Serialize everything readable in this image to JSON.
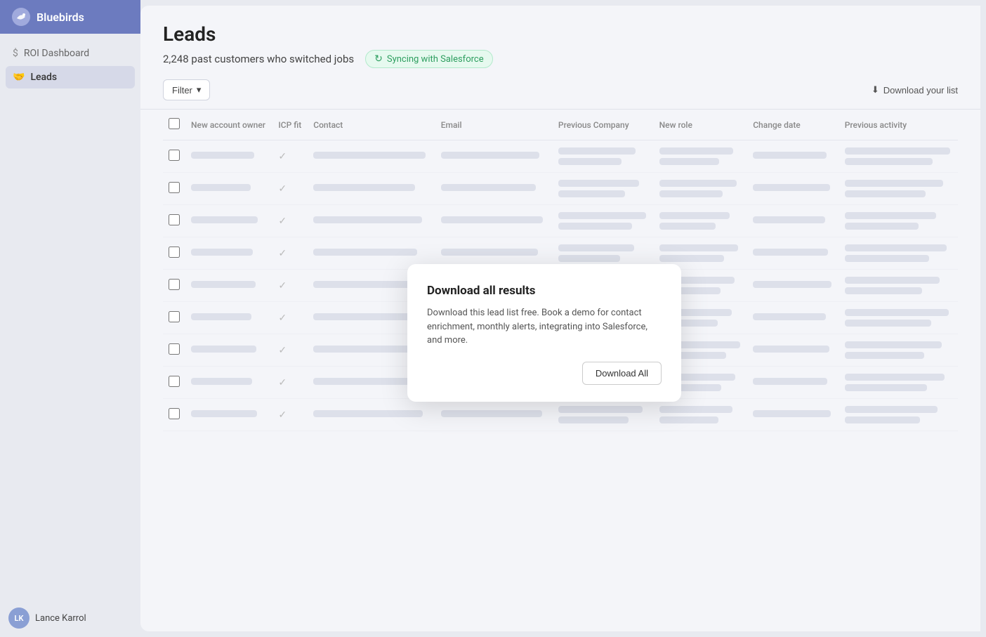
{
  "app": {
    "name": "Bluebirds",
    "logo_icon": "🐦"
  },
  "sidebar": {
    "nav_items": [
      {
        "id": "roi-dashboard",
        "label": "ROI Dashboard",
        "icon": "$",
        "active": false
      },
      {
        "id": "leads",
        "label": "Leads",
        "icon": "🤝",
        "active": true
      }
    ],
    "user": {
      "initials": "LK",
      "name": "Lance Karrol"
    }
  },
  "main": {
    "page_title": "Leads",
    "subtitle": "2,248 past customers who switched jobs",
    "sync_label": "Syncing with Salesforce",
    "filter_label": "Filter",
    "download_list_label": "Download your list",
    "table": {
      "columns": [
        "New account owner",
        "ICP fit",
        "Contact",
        "Email",
        "Previous Company",
        "New role",
        "Change date",
        "Previous activity"
      ],
      "rows": 9
    },
    "popup": {
      "title": "Download all results",
      "description": "Download this lead list free. Book a demo for contact enrichment, monthly alerts, integrating into Salesforce, and more.",
      "button_label": "Download All"
    }
  }
}
